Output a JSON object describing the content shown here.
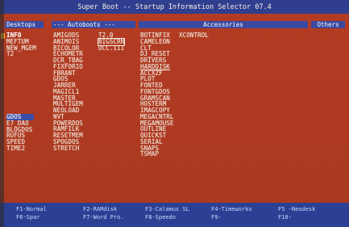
{
  "window": {
    "title": "Super Boot -- Startup Information Selector 07.4"
  },
  "headers": {
    "desktops": "Desktops",
    "autoboots": "--- Autoboots ---",
    "accessories": "Accessories",
    "others": "Others"
  },
  "desktops": {
    "items_top": [
      "INFO",
      "MEFTUM",
      "NEW_MGEM",
      "T2"
    ],
    "items_bottom": [
      "GDOS",
      "E7_DAO",
      "BLOGDOS",
      "RUFUS",
      "SPEED",
      "TIME2"
    ]
  },
  "autoboots_col1": [
    "AMIGODS",
    "ANIMOIS",
    "BICOLOR",
    "ECHOMETR",
    "DCR_TBAG",
    "FIXFORIO",
    "FBRANT",
    "GDOS",
    "JARRER",
    "MAGICL1",
    "MASTER",
    "MULTIGEM",
    "NEOLOAD",
    "NVT",
    "POWERDOS",
    "RAMFILK",
    "RESETMEM",
    "SPOGDOS",
    "STRETCH"
  ],
  "autoboots_col2": [
    "T2.0",
    "BIGSCRN",
    "DCC.III"
  ],
  "accessories_col1": [
    "BOTINFIX",
    "CAMELEON",
    "CLT",
    "DJ_RESET",
    "DRIVERS",
    "HARDDISK",
    "ACCXZF",
    "PLOT",
    "FONTED",
    "FONTGDOS",
    "GRAMSCAN",
    "HOSTERM",
    "IMAGCOPY",
    "MEGACNTRL",
    "MEGAMOUSE",
    "OUTLINE",
    "QUICKST",
    "SERIAL",
    "SNAPS",
    "TSMAP"
  ],
  "accessories_col2": [
    "XCONTROL"
  ],
  "footer": {
    "row1": [
      "F1-Normal",
      "F2-RAMdisk",
      "F3-Calamus SL",
      "F4-Timeworks",
      "F5 -Neodesk"
    ],
    "row2": [
      "F6-Spar",
      "F7-Word Pro.",
      "F8-Speedo",
      "F9-",
      "F10-"
    ]
  },
  "colors": {
    "background": "#b03b22",
    "titlebar": "#2f3e8e",
    "highlight": "#3b4ea6",
    "cursor": "#f2b325",
    "text": "#f2ece0"
  }
}
